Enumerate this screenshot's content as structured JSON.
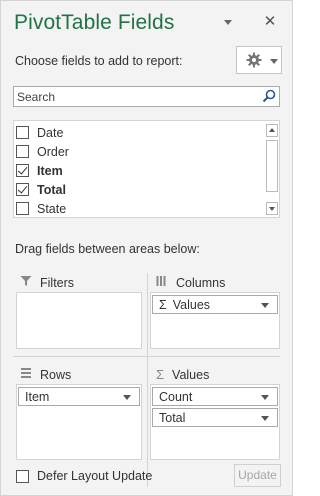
{
  "header": {
    "title": "PivotTable Fields",
    "close_glyph": "✕"
  },
  "choose_label": "Choose fields to add to report:",
  "search": {
    "placeholder": "Search",
    "value": ""
  },
  "fields": [
    {
      "label": "Date",
      "checked": false,
      "bold": false
    },
    {
      "label": "Order",
      "checked": false,
      "bold": false
    },
    {
      "label": "Item",
      "checked": true,
      "bold": true
    },
    {
      "label": "Total",
      "checked": true,
      "bold": true
    },
    {
      "label": "State",
      "checked": false,
      "bold": false
    }
  ],
  "drag_label": "Drag fields between areas below:",
  "areas": {
    "filters": {
      "title": "Filters",
      "items": []
    },
    "columns": {
      "title": "Columns",
      "items": [
        "Values"
      ]
    },
    "rows": {
      "title": "Rows",
      "items": [
        "Item"
      ]
    },
    "values": {
      "title": "Values",
      "items": [
        "Count",
        "Total"
      ]
    }
  },
  "footer": {
    "defer_label": "Defer Layout Update",
    "defer_checked": false,
    "update_label": "Update"
  },
  "colors": {
    "title": "#217346",
    "background": "#f3f3f3"
  }
}
